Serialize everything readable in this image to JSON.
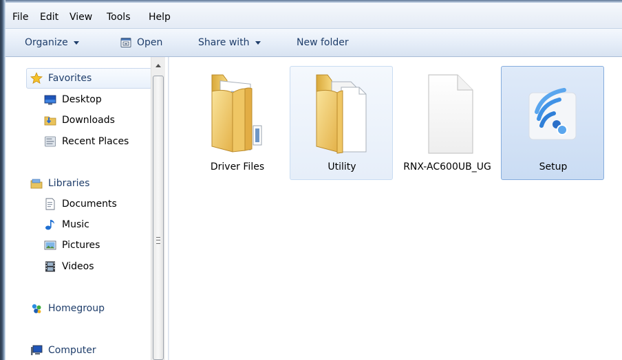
{
  "menu": {
    "file": "File",
    "edit": "Edit",
    "view": "View",
    "tools": "Tools",
    "help": "Help"
  },
  "commands": {
    "organize": "Organize",
    "open": "Open",
    "share_with": "Share with",
    "new_folder": "New folder"
  },
  "navigation": {
    "favorites": {
      "label": "Favorites",
      "items": [
        {
          "label": "Desktop",
          "icon": "desktop-icon"
        },
        {
          "label": "Downloads",
          "icon": "downloads-folder-icon"
        },
        {
          "label": "Recent Places",
          "icon": "recent-places-icon"
        }
      ]
    },
    "libraries": {
      "label": "Libraries",
      "items": [
        {
          "label": "Documents",
          "icon": "documents-icon"
        },
        {
          "label": "Music",
          "icon": "music-note-icon"
        },
        {
          "label": "Pictures",
          "icon": "pictures-icon"
        },
        {
          "label": "Videos",
          "icon": "film-icon"
        }
      ]
    },
    "homegroup": "Homegroup",
    "computer": "Computer"
  },
  "files": [
    {
      "label": "Driver Files",
      "type": "folder",
      "state": "normal"
    },
    {
      "label": "Utility",
      "type": "folder",
      "state": "hover"
    },
    {
      "label": "RNX-AC600UB_UG",
      "type": "document",
      "state": "normal"
    },
    {
      "label": "Setup",
      "type": "application",
      "state": "selected"
    }
  ],
  "colors": {
    "command_text": "#1e3d6a",
    "selection_border": "#84acdd",
    "selection_fill": "#cadcf3",
    "wifi_blue": "#2f7fd8"
  }
}
